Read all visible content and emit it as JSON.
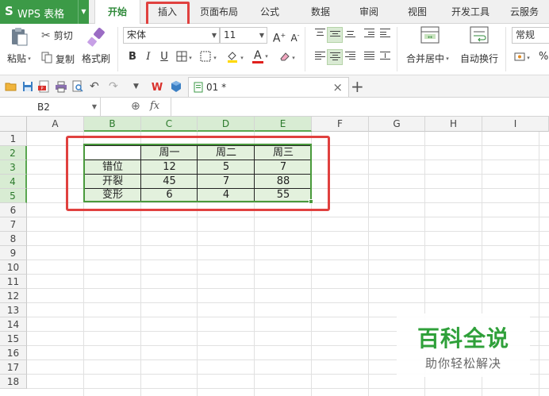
{
  "app": {
    "logo": "S",
    "name": "WPS 表格"
  },
  "tabs": [
    {
      "label": "开始",
      "active": true
    },
    {
      "label": "插入",
      "active": false
    },
    {
      "label": "页面布局",
      "active": false
    },
    {
      "label": "公式",
      "active": false
    },
    {
      "label": "数据",
      "active": false
    },
    {
      "label": "审阅",
      "active": false
    },
    {
      "label": "视图",
      "active": false
    },
    {
      "label": "开发工具",
      "active": false
    },
    {
      "label": "云服务",
      "active": false
    }
  ],
  "ribbon": {
    "paste": "粘贴",
    "cut": "剪切",
    "copy": "复制",
    "format_painter": "格式刷",
    "font_name": "宋体",
    "font_size": "11",
    "merge_center": "合并居中",
    "wrap_text": "自动换行",
    "number_format": "常规",
    "bold": "B",
    "italic": "I",
    "underline": "U",
    "font_color_letter": "A",
    "percent": "%"
  },
  "document": {
    "tab_name": "01 *"
  },
  "formula_bar": {
    "name_box": "B2",
    "fx": "fx",
    "formula": ""
  },
  "columns": [
    "A",
    "B",
    "C",
    "D",
    "E",
    "F",
    "G",
    "H",
    "I"
  ],
  "rows": [
    "1",
    "2",
    "3",
    "4",
    "5",
    "6",
    "7",
    "8",
    "9",
    "10",
    "11",
    "12",
    "13",
    "14",
    "15",
    "16",
    "17",
    "18"
  ],
  "table": {
    "header": [
      "",
      "周一",
      "周二",
      "周三"
    ],
    "rows": [
      [
        "错位",
        "12",
        "5",
        "7"
      ],
      [
        "开裂",
        "45",
        "7",
        "88"
      ],
      [
        "变形",
        "6",
        "4",
        "55"
      ]
    ]
  },
  "watermark": {
    "title": "百科全说",
    "subtitle": "助你轻松解决"
  },
  "colors": {
    "accent_green": "#3c9a47",
    "highlight_red": "#e0413f",
    "selection_fill": "#e3f1dd"
  }
}
